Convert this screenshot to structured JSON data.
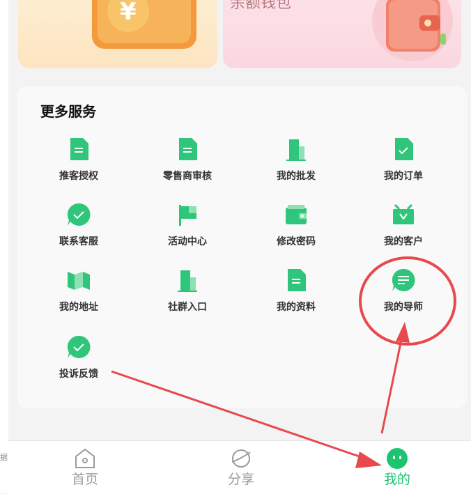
{
  "top_cards": {
    "right_label": "余额钱包"
  },
  "services": {
    "title": "更多服务",
    "items": [
      {
        "label": "推客授权",
        "icon": "document-icon"
      },
      {
        "label": "零售商审核",
        "icon": "document-icon"
      },
      {
        "label": "我的批发",
        "icon": "building-icon"
      },
      {
        "label": "我的订单",
        "icon": "checklist-icon"
      },
      {
        "label": "联系客服",
        "icon": "check-bubble-icon"
      },
      {
        "label": "活动中心",
        "icon": "flag-icon"
      },
      {
        "label": "修改密码",
        "icon": "wallet-icon"
      },
      {
        "label": "我的客户",
        "icon": "customer-box-icon"
      },
      {
        "label": "我的地址",
        "icon": "map-icon"
      },
      {
        "label": "社群入口",
        "icon": "building-icon"
      },
      {
        "label": "我的资料",
        "icon": "document-icon"
      },
      {
        "label": "我的导师",
        "icon": "chat-bubble-icon"
      },
      {
        "label": "投诉反馈",
        "icon": "check-bubble-icon"
      }
    ]
  },
  "tabbar": {
    "home": "首页",
    "share": "分享",
    "mine": "我的"
  },
  "colors": {
    "accent_green": "#1dc470",
    "annotation_red": "#e8494d"
  }
}
